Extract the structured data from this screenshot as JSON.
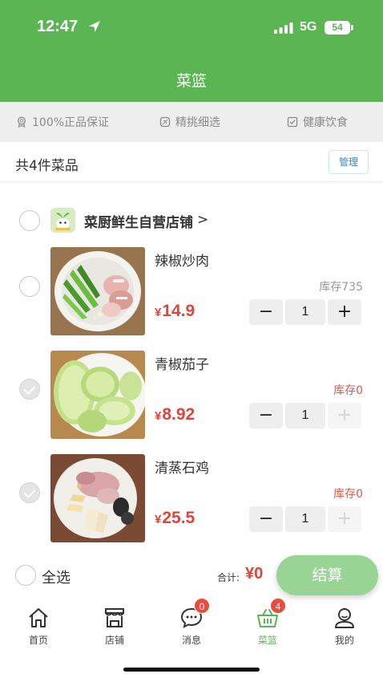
{
  "status_bar": {
    "time": "12:47",
    "network": "5G",
    "battery": "54"
  },
  "header": {
    "title": "菜篮"
  },
  "promises": [
    {
      "icon": "badge-icon",
      "label": "100%正品保证"
    },
    {
      "icon": "leaf-icon",
      "label": "精挑细选"
    },
    {
      "icon": "check-square-icon",
      "label": "健康饮食"
    }
  ],
  "cart": {
    "count_text": "共4件菜品",
    "manage_label": "管理",
    "shop": {
      "name": "菜厨鲜生自营店铺",
      "arrow": ">"
    },
    "items": [
      {
        "name": "辣椒炒肉",
        "stock": "库存735",
        "currency": "¥",
        "price": "14.9",
        "quantity": "1",
        "minus": "−",
        "plus": "+"
      },
      {
        "name": "青椒茄子",
        "stock": "库存0",
        "currency": "¥",
        "price": "8.92",
        "quantity": "1",
        "minus": "−",
        "plus": "+"
      },
      {
        "name": "清蒸石鸡",
        "stock": "库存0",
        "currency": "¥",
        "price": "25.5",
        "quantity": "1",
        "minus": "−",
        "plus": "+"
      }
    ]
  },
  "checkout": {
    "select_all": "全选",
    "total_label": "合计:",
    "total_value": "¥0",
    "button": "结算"
  },
  "tabbar": {
    "tabs": [
      {
        "label": "首页",
        "icon": "home-icon"
      },
      {
        "label": "店铺",
        "icon": "store-icon"
      },
      {
        "label": "消息",
        "icon": "message-icon",
        "badge": "0"
      },
      {
        "label": "菜篮",
        "icon": "basket-icon",
        "badge": "4"
      },
      {
        "label": "我的",
        "icon": "user-icon"
      }
    ]
  },
  "colors": {
    "brand": "#5bb553",
    "price": "#e0443a",
    "checkout_button": "#98d493",
    "badge": "#e94b3c"
  }
}
